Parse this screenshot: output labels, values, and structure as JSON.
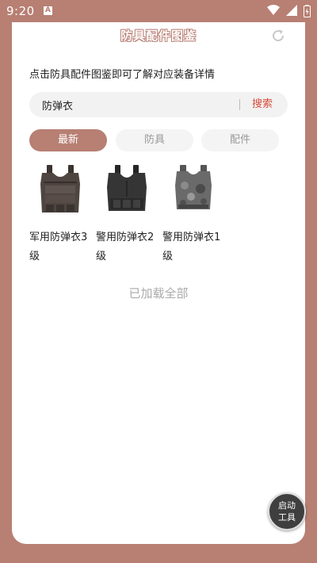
{
  "status": {
    "time": "9:20",
    "notification_glyph": "A"
  },
  "header": {
    "title": "防具配件图鉴"
  },
  "intro": {
    "text": "点击防具配件图鉴即可了解对应装备详情"
  },
  "search": {
    "value": "防弹衣",
    "button_label": "搜索"
  },
  "tabs": [
    {
      "label": "最新",
      "active": true
    },
    {
      "label": "防具",
      "active": false
    },
    {
      "label": "配件",
      "active": false
    }
  ],
  "items": [
    {
      "name": "军用防弹衣3级",
      "icon": "vest-level-3-icon"
    },
    {
      "name": "警用防弹衣2级",
      "icon": "vest-level-2-icon"
    },
    {
      "name": "警用防弹衣1级",
      "icon": "vest-level-1-icon"
    }
  ],
  "list_end": {
    "text": "已加载全部"
  },
  "float_button": {
    "line1": "启动",
    "line2": "工具"
  },
  "colors": {
    "accent": "#b87f73",
    "search_button": "#d84b3a",
    "background": "#b87f73"
  }
}
